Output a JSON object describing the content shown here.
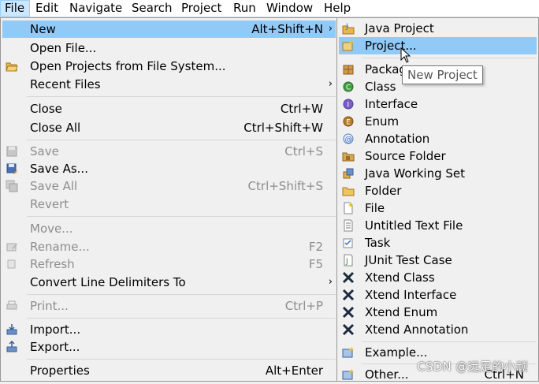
{
  "menubar": {
    "items": [
      "File",
      "Edit",
      "Navigate",
      "Search",
      "Project",
      "Run",
      "Window",
      "Help"
    ]
  },
  "file_menu": {
    "new": {
      "label": "New",
      "shortcut": "Alt+Shift+N"
    },
    "open_file": {
      "label": "Open File..."
    },
    "open_projects": {
      "label": "Open Projects from File System..."
    },
    "recent_files": {
      "label": "Recent Files"
    },
    "close": {
      "label": "Close",
      "shortcut": "Ctrl+W"
    },
    "close_all": {
      "label": "Close All",
      "shortcut": "Ctrl+Shift+W"
    },
    "save": {
      "label": "Save",
      "shortcut": "Ctrl+S"
    },
    "save_as": {
      "label": "Save As..."
    },
    "save_all": {
      "label": "Save All",
      "shortcut": "Ctrl+Shift+S"
    },
    "revert": {
      "label": "Revert"
    },
    "move": {
      "label": "Move..."
    },
    "rename": {
      "label": "Rename...",
      "shortcut": "F2"
    },
    "refresh": {
      "label": "Refresh",
      "shortcut": "F5"
    },
    "convert": {
      "label": "Convert Line Delimiters To"
    },
    "print": {
      "label": "Print...",
      "shortcut": "Ctrl+P"
    },
    "import": {
      "label": "Import..."
    },
    "export": {
      "label": "Export..."
    },
    "properties": {
      "label": "Properties",
      "shortcut": "Alt+Enter"
    }
  },
  "new_submenu": {
    "java_project": "Java Project",
    "project": "Project...",
    "package": "Package",
    "class": "Class",
    "interface": "Interface",
    "enum": "Enum",
    "annotation": "Annotation",
    "source_folder": "Source Folder",
    "java_working_set": "Java Working Set",
    "folder": "Folder",
    "file": "File",
    "untitled_text_file": "Untitled Text File",
    "task": "Task",
    "junit_test_case": "JUnit Test Case",
    "xtend_class": "Xtend Class",
    "xtend_interface": "Xtend Interface",
    "xtend_enum": "Xtend Enum",
    "xtend_annotation": "Xtend Annotation",
    "example": "Example...",
    "other": {
      "label": "Other...",
      "shortcut": "Ctrl+N"
    }
  },
  "tooltip": "New Project",
  "watermark": "CSDN @远足的小顽",
  "colors": {
    "menu_bg": "#f0f0f0",
    "highlight": "#91c9f7",
    "menubar_active": "#cce8ff",
    "disabled_text": "#8d8d8d"
  }
}
